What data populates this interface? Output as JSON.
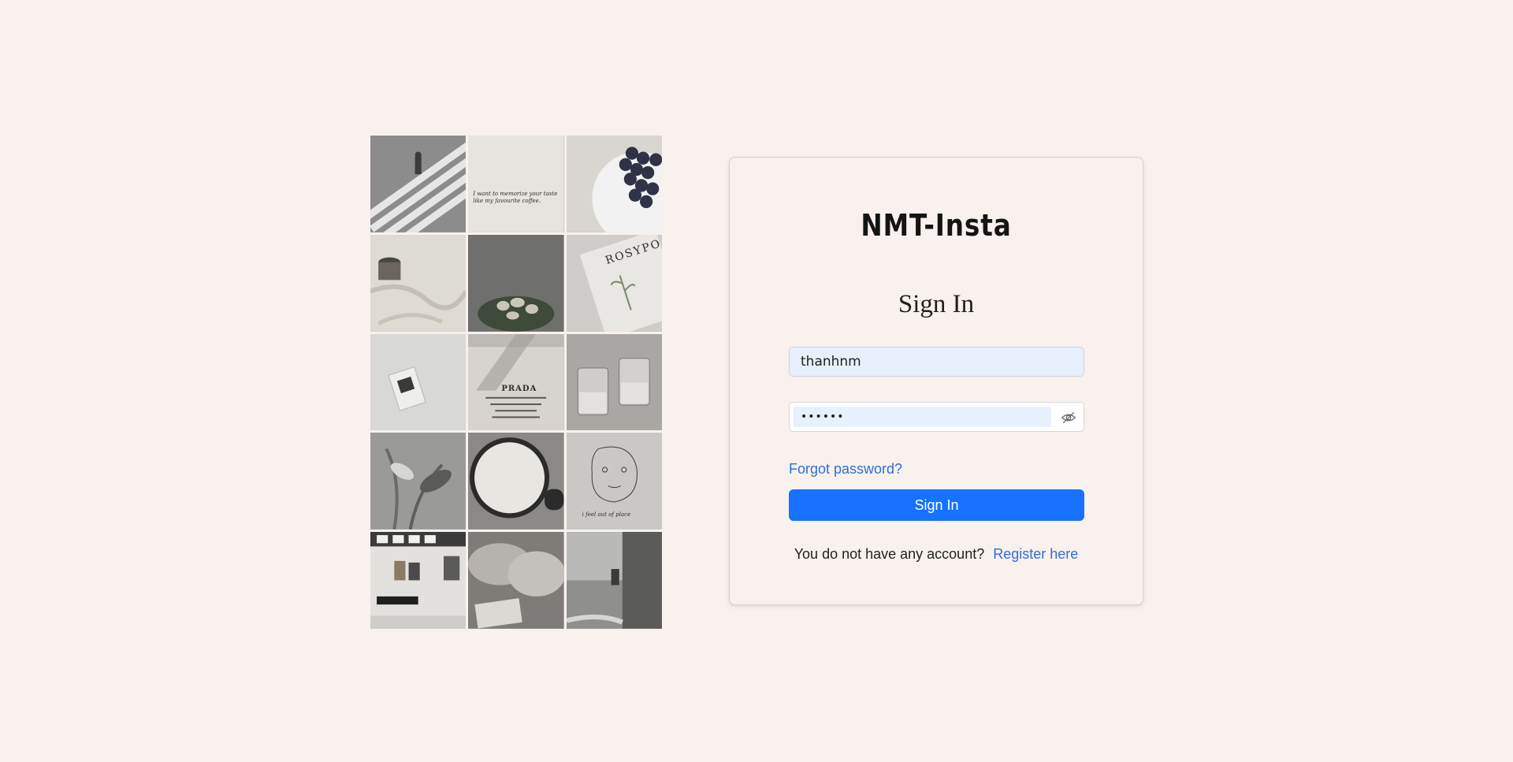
{
  "brand": {
    "logo_text": "NMT-Insta"
  },
  "form": {
    "title": "Sign In",
    "username": {
      "value": "thanhnm"
    },
    "password": {
      "value": "••••••",
      "toggle_icon": "eye-slash-icon"
    },
    "forgot_label": "Forgot password?",
    "submit_label": "Sign In",
    "register_prompt": "You do not have any account?",
    "register_link": "Register here"
  },
  "collage": {
    "tiles": [
      {
        "name": "crosswalk-photo"
      },
      {
        "name": "handwritten-note-photo",
        "caption": "I want to memorize your taste like my favourite coffee."
      },
      {
        "name": "grapes-plate-photo"
      },
      {
        "name": "coffee-on-bed-photo"
      },
      {
        "name": "plant-bowl-photo"
      },
      {
        "name": "magazine-photo",
        "caption": "ROSYPO"
      },
      {
        "name": "books-on-sheet-photo"
      },
      {
        "name": "prada-card-photo",
        "caption": "PRADA"
      },
      {
        "name": "glasses-photo"
      },
      {
        "name": "lily-shadow-photo"
      },
      {
        "name": "latte-mug-photo"
      },
      {
        "name": "face-sketch-photo",
        "caption": "i feel out of place"
      },
      {
        "name": "gallery-room-photo"
      },
      {
        "name": "pillows-photo"
      },
      {
        "name": "balcony-sea-photo"
      }
    ]
  },
  "colors": {
    "background": "#f9f1ee",
    "primary": "#1672ff",
    "link": "#2f6fd4",
    "input_autofill": "#e8effd"
  }
}
